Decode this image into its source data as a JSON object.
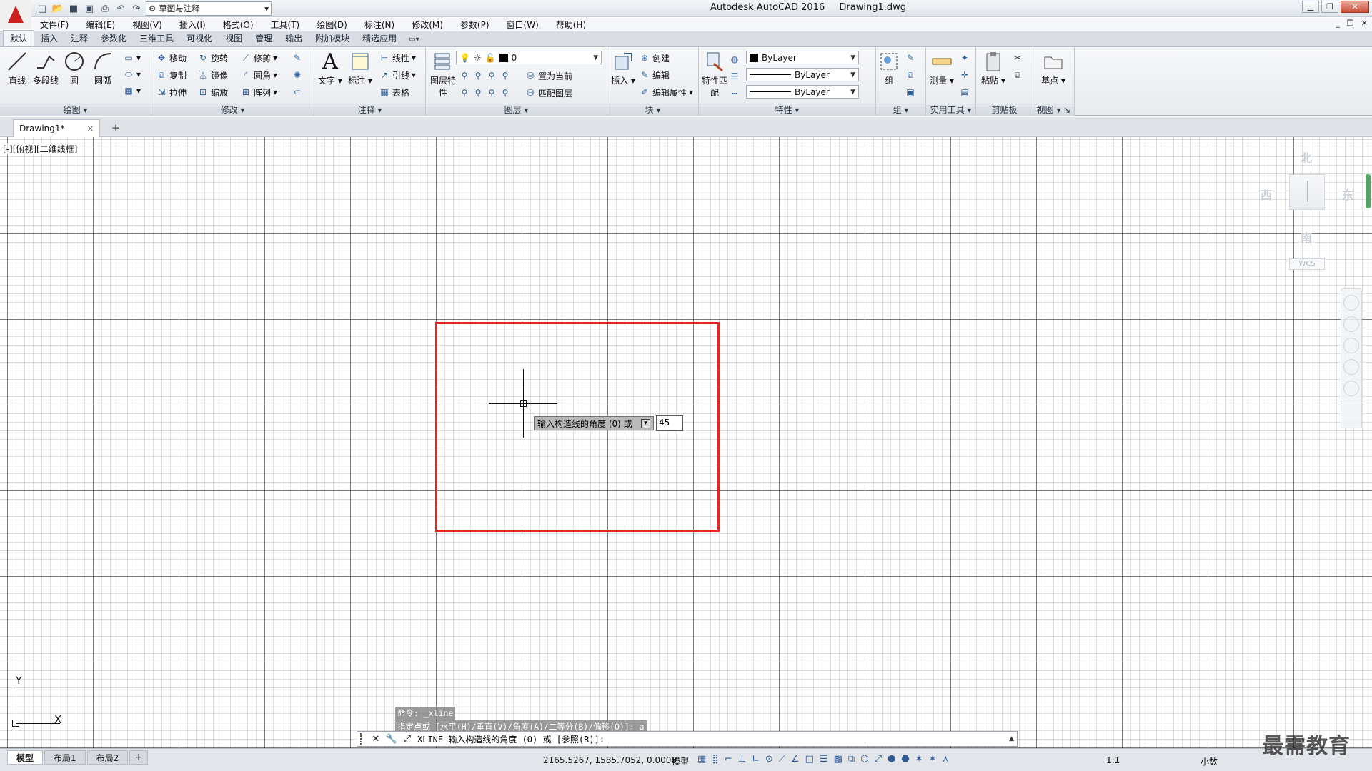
{
  "titlebar": {
    "app_name": "Autodesk AutoCAD 2016",
    "document": "Drawing1.dwg",
    "workspace": "草图与注释"
  },
  "menu": [
    "文件(F)",
    "编辑(E)",
    "视图(V)",
    "插入(I)",
    "格式(O)",
    "工具(T)",
    "绘图(D)",
    "标注(N)",
    "修改(M)",
    "参数(P)",
    "窗口(W)",
    "帮助(H)"
  ],
  "ribbon_tabs": [
    "默认",
    "插入",
    "注释",
    "参数化",
    "三维工具",
    "可视化",
    "视图",
    "管理",
    "输出",
    "附加模块",
    "精选应用"
  ],
  "ribbon": {
    "draw": {
      "title": "绘图",
      "line": "直线",
      "polyline": "多段线",
      "circle": "圆",
      "arc": "圆弧"
    },
    "modify": {
      "title": "修改",
      "move": "移动",
      "rotate": "旋转",
      "trim": "修剪",
      "copy": "复制",
      "mirror": "镜像",
      "fillet": "圆角",
      "stretch": "拉伸",
      "scale": "缩放",
      "array": "阵列"
    },
    "annotation": {
      "title": "注释",
      "text": "文字",
      "dimension": "标注",
      "linear": "线性",
      "leader": "引线",
      "table": "表格"
    },
    "layers": {
      "title": "图层",
      "layer_props": "图层特性",
      "current_layer": "0",
      "make_current": "置为当前",
      "match_layer": "匹配图层"
    },
    "block": {
      "title": "块",
      "insert": "插入",
      "create": "创建",
      "edit": "编辑",
      "edit_attr": "编辑属性"
    },
    "properties": {
      "title": "特性",
      "match": "特性匹配",
      "color": "ByLayer",
      "linetype": "ByLayer",
      "lineweight": "ByLayer"
    },
    "groups": {
      "title": "组",
      "group": "组"
    },
    "utilities": {
      "title": "实用工具",
      "measure": "测量"
    },
    "clipboard": {
      "title": "剪贴板",
      "paste": "粘贴"
    },
    "view": {
      "title": "视图",
      "base": "基点"
    }
  },
  "file_tab": "Drawing1*",
  "canvas": {
    "view_label": "[-][俯视][二维线框]",
    "tooltip": "输入构造线的角度 (0) 或",
    "angle_value": "45",
    "accent_color": "#e8251e"
  },
  "viewcube": {
    "north": "北",
    "south": "南",
    "east": "东",
    "west": "西",
    "wcs": "WCS"
  },
  "ucs": {
    "x": "X",
    "y": "Y"
  },
  "command": {
    "history": [
      "命令: _xline",
      "指定点或 [水平(H)/垂直(V)/角度(A)/二等分(B)/偏移(O)]: a"
    ],
    "prompt": "XLINE 输入构造线的角度 (0) 或 [参照(R)]:"
  },
  "layout_tabs": [
    "模型",
    "布局1",
    "布局2"
  ],
  "status": {
    "coords": "2165.5267, 1585.7052, 0.0000",
    "mode": "模型",
    "scale": "1:1",
    "units": "小数"
  },
  "watermark": "最需教育"
}
